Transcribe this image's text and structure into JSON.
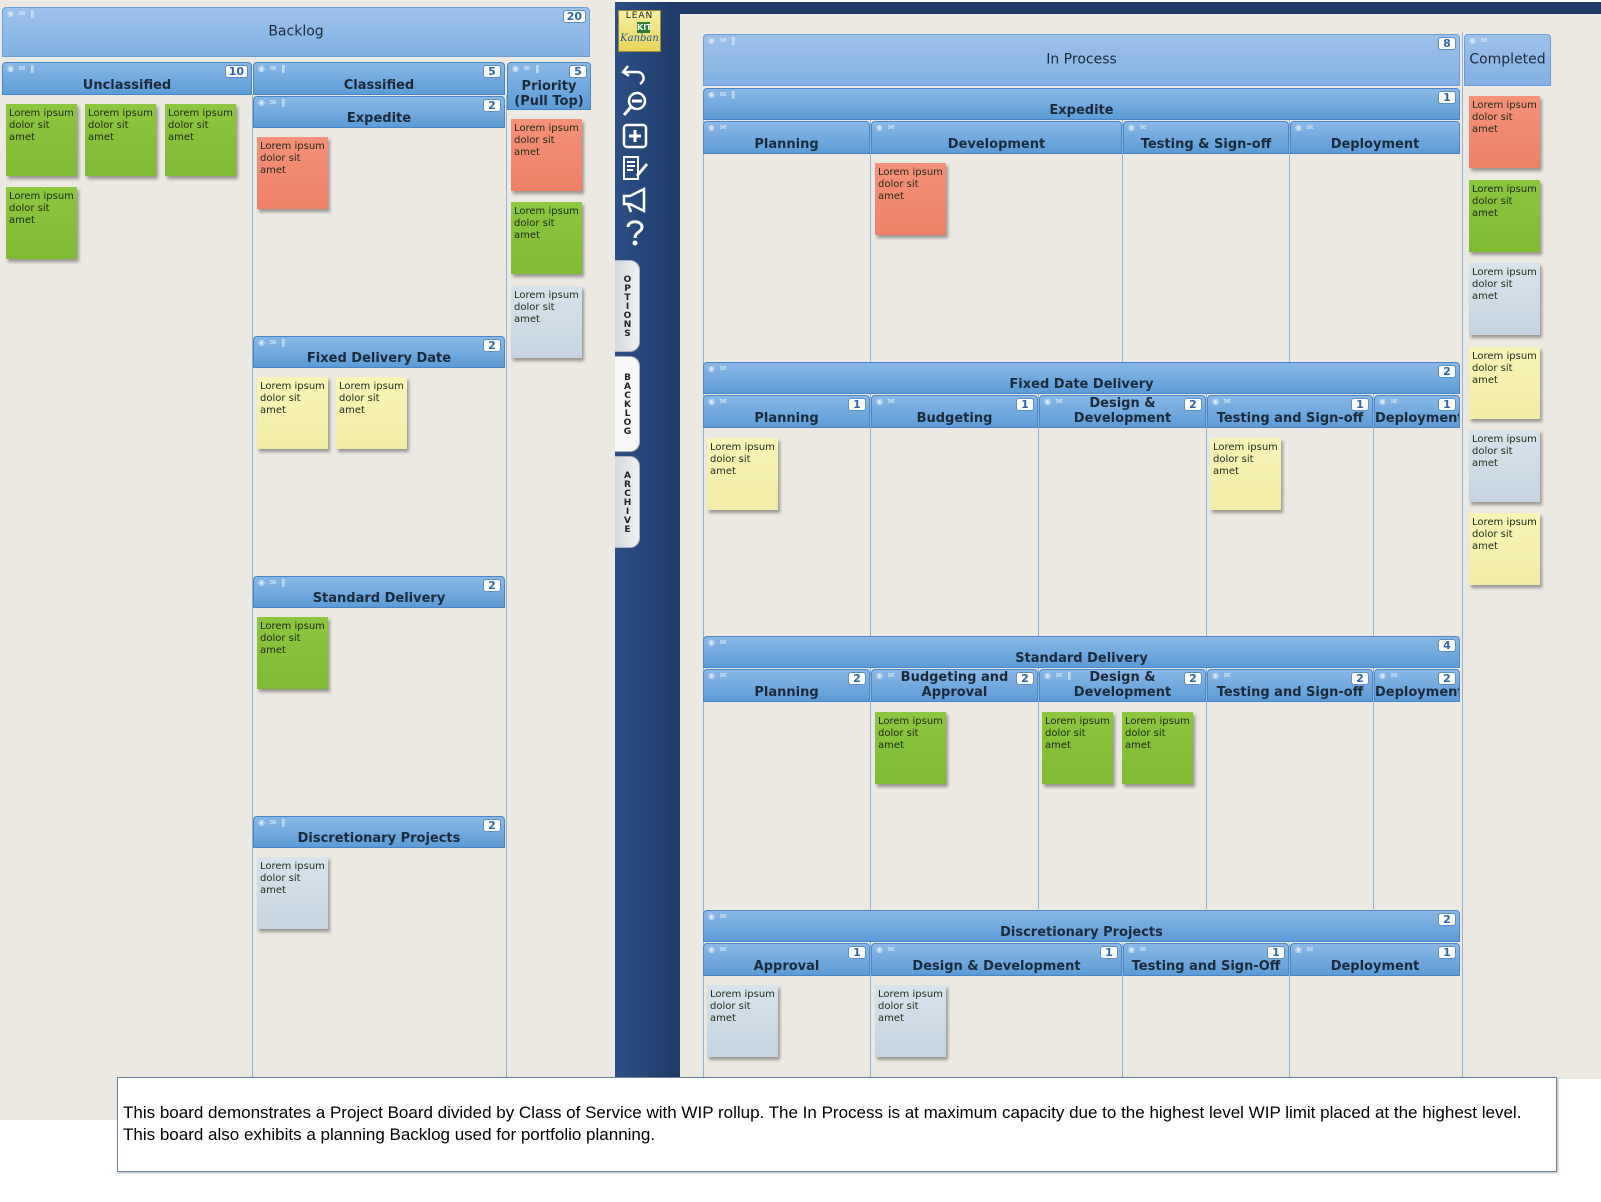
{
  "app": {
    "logo_line1": "LEAN",
    "logo_line2": "KIT",
    "logo_line3": "Kanban"
  },
  "side_tabs": {
    "options": "OPTIONS",
    "backlog": "BACKLOG",
    "archive": "ARCHIVE"
  },
  "card_text": "Lorem ipsum dolor sit amet",
  "lanes": {
    "backlog": {
      "title": "Backlog",
      "wip": "20"
    },
    "unclassified": {
      "title": "Unclassified",
      "wip": "10"
    },
    "classified": {
      "title": "Classified",
      "wip": "5"
    },
    "priority": {
      "title": "Priority (Pull Top)",
      "wip": "5"
    },
    "bl_expedite": {
      "title": "Expedite",
      "wip": "2"
    },
    "bl_fixed": {
      "title": "Fixed Delivery Date",
      "wip": "2"
    },
    "bl_standard": {
      "title": "Standard Delivery",
      "wip": "2"
    },
    "bl_discretionary": {
      "title": "Discretionary Projects",
      "wip": "2"
    },
    "in_process": {
      "title": "In Process",
      "wip": "8"
    },
    "completed": {
      "title": "Completed"
    },
    "exp": {
      "title": "Expedite",
      "wip": "1"
    },
    "exp_planning": {
      "title": "Planning"
    },
    "exp_development": {
      "title": "Development"
    },
    "exp_testing": {
      "title": "Testing & Sign-off"
    },
    "exp_deployment": {
      "title": "Deployment"
    },
    "fdd": {
      "title": "Fixed Date Delivery",
      "wip": "2"
    },
    "fdd_planning": {
      "title": "Planning",
      "wip": "1"
    },
    "fdd_budgeting": {
      "title": "Budgeting",
      "wip": "1"
    },
    "fdd_design": {
      "title": "Design & Development",
      "wip": "2"
    },
    "fdd_testing": {
      "title": "Testing and Sign-off",
      "wip": "1"
    },
    "fdd_deployment": {
      "title": "Deployment",
      "wip": "1"
    },
    "sd": {
      "title": "Standard Delivery",
      "wip": "4"
    },
    "sd_planning": {
      "title": "Planning",
      "wip": "2"
    },
    "sd_budgeting": {
      "title": "Budgeting and Approval",
      "wip": "2"
    },
    "sd_design": {
      "title": "Design & Development",
      "wip": "2"
    },
    "sd_testing": {
      "title": "Testing and Sign-off",
      "wip": "2"
    },
    "sd_deployment": {
      "title": "Deployment",
      "wip": "2"
    },
    "dp": {
      "title": "Discretionary Projects",
      "wip": "2"
    },
    "dp_approval": {
      "title": "Approval",
      "wip": "1"
    },
    "dp_design": {
      "title": "Design & Development",
      "wip": "1"
    },
    "dp_testing": {
      "title": "Testing and Sign-Off",
      "wip": "1"
    },
    "dp_deployment": {
      "title": "Deployment",
      "wip": "1"
    }
  },
  "cards": [
    {
      "lane": "unclassified",
      "color": "green"
    },
    {
      "lane": "unclassified",
      "color": "green"
    },
    {
      "lane": "unclassified",
      "color": "green"
    },
    {
      "lane": "unclassified",
      "color": "green"
    },
    {
      "lane": "bl_expedite",
      "color": "red"
    },
    {
      "lane": "bl_fixed",
      "color": "yellow"
    },
    {
      "lane": "bl_fixed",
      "color": "yellow"
    },
    {
      "lane": "bl_standard",
      "color": "green"
    },
    {
      "lane": "bl_discretionary",
      "color": "blue"
    },
    {
      "lane": "priority",
      "color": "red"
    },
    {
      "lane": "priority",
      "color": "green"
    },
    {
      "lane": "priority",
      "color": "blue"
    },
    {
      "lane": "exp_development",
      "color": "red"
    },
    {
      "lane": "fdd_planning",
      "color": "yellow"
    },
    {
      "lane": "fdd_testing",
      "color": "yellow"
    },
    {
      "lane": "sd_budgeting",
      "color": "green"
    },
    {
      "lane": "sd_design",
      "color": "green"
    },
    {
      "lane": "sd_design",
      "color": "green"
    },
    {
      "lane": "dp_approval",
      "color": "blue"
    },
    {
      "lane": "dp_design",
      "color": "blue"
    },
    {
      "lane": "completed",
      "color": "red"
    },
    {
      "lane": "completed",
      "color": "green"
    },
    {
      "lane": "completed",
      "color": "blue"
    },
    {
      "lane": "completed",
      "color": "yellow"
    },
    {
      "lane": "completed",
      "color": "blue"
    },
    {
      "lane": "completed",
      "color": "yellow"
    }
  ],
  "note": "This board demonstrates a Project Board divided by Class of Service with WIP rollup.  The In Process is at maximum capacity due to the highest level WIP limit placed at the highest level.  This board also exhibits a planning Backlog used for portfolio planning."
}
